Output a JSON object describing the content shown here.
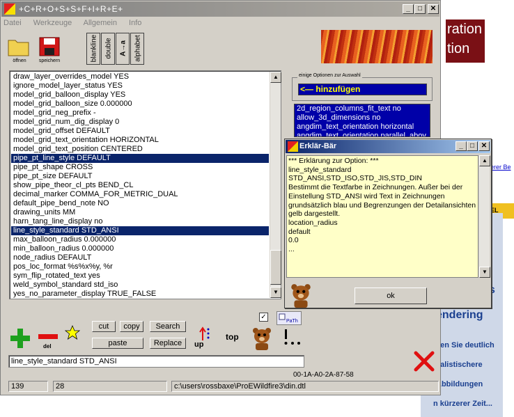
{
  "background": {
    "banner_text": "ration\ntion",
    "link_text": "erer Be",
    "orange_text": "EL",
    "features": [
      "s",
      "endering",
      "llen Sie deutlich",
      "ealistischere",
      "Abbildungen",
      "n kürzerer Zeit..."
    ]
  },
  "window": {
    "title": "+C+R+O+S+S+F+I+R+E+",
    "controls": {
      "minimize": "_",
      "maximize": "□",
      "close": "✕"
    },
    "menu": [
      "Datei",
      "Werkzeuge",
      "Allgemein",
      "Info"
    ],
    "toolbar": {
      "open_label": "öffnen",
      "save_label": "speichern",
      "vertical_buttons": [
        "blankline",
        "double",
        "A→a",
        "alphabet"
      ]
    },
    "list_items": [
      "draw_layer_overrides_model YES",
      "ignore_model_layer_status YES",
      "model_grid_balloon_display YES",
      "model_grid_balloon_size 0.000000",
      "model_grid_neg_prefix -",
      "model_grid_num_dig_display 0",
      "model_grid_offset DEFAULT",
      "model_grid_text_orientation HORIZONTAL",
      "model_grid_text_position CENTERED",
      "pipe_pt_line_style DEFAULT",
      "pipe_pt_shape CROSS",
      "pipe_pt_size DEFAULT",
      "show_pipe_theor_cl_pts BEND_CL",
      "decimal_marker COMMA_FOR_METRIC_DUAL",
      "default_pipe_bend_note NO",
      "drawing_units MM",
      "harn_tang_line_display no",
      "line_style_standard STD_ANSI",
      "max_balloon_radius 0.000000",
      "min_balloon_radius 0.000000",
      "node_radius DEFAULT",
      "pos_loc_format %s%x%y, %r",
      "sym_flip_rotated_text yes",
      "weld_symbol_standard std_iso",
      "yes_no_parameter_display TRUE_FALSE"
    ],
    "selected_list_items": [
      9,
      17
    ],
    "options_group": {
      "title": "einige Optionen zur Auswahl",
      "add_button": "<— hinzufügen",
      "options": [
        "2d_region_columns_fit_text no",
        "allow_3d_dimensions no",
        "angdim_text_orientation horizontal",
        "angdim_text_orientation parallel_abov"
      ]
    },
    "actions": {
      "add_label": "+",
      "del_label": "del",
      "cut": "cut",
      "copy": "copy",
      "search": "Search",
      "paste": "paste",
      "replace": "Replace",
      "up": "up",
      "top": "top",
      "path_label": "PaTh",
      "checkbox_checked": true
    },
    "edit_value": "line_style_standard STD_ANSI",
    "code": "00-1A-A0-2A-87-58",
    "status": {
      "line": "139",
      "col": "28",
      "path": "c:\\users\\rossbaxe\\ProEWildfire3\\din.dtl"
    }
  },
  "dialog": {
    "title": "Erklär-Bär",
    "lines": [
      "*** Erklärung zur Option: ***",
      "line_style_standard",
      "STD_ANSI,STD_ISO,STD_JIS,STD_DIN",
      "Bestimmt die Textfarbe in Zeichnungen. Außer bei der",
      "Einstellung STD_ANSI wird Text in Zeichnungen",
      "grundsätzlich blau und Begrenzungen der Detailansichten",
      "gelb dargestellt.",
      "location_radius",
      "default",
      "0.0",
      "..."
    ],
    "ok": "ok"
  },
  "colors": {
    "selection": "#0a246a",
    "options_bg": "#0000a8",
    "add_text": "#ffff00",
    "explain_bg": "#ffffc8",
    "plus": "#1ea01e",
    "minus": "#e01010"
  }
}
